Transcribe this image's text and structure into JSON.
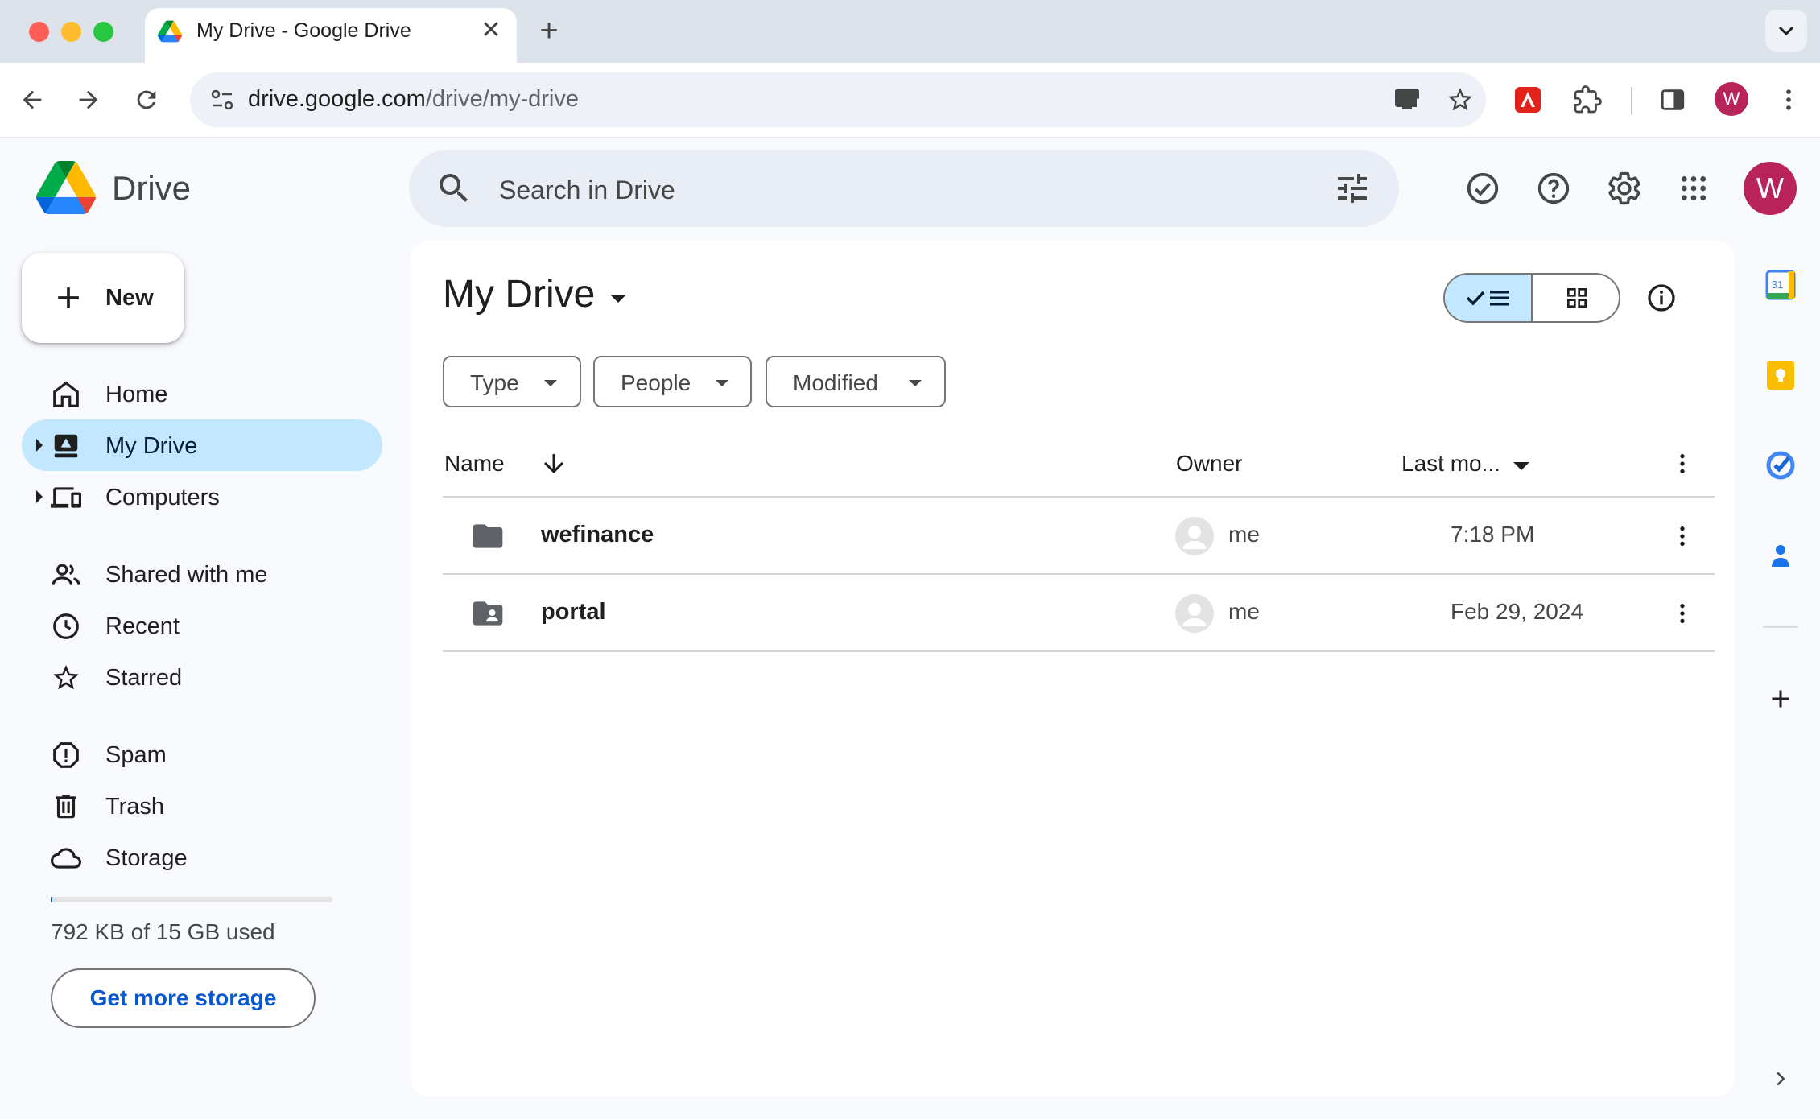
{
  "browser": {
    "tab_title": "My Drive - Google Drive",
    "url_host": "drive.google.com",
    "url_path": "/drive/my-drive",
    "profile_initial": "W"
  },
  "header": {
    "app_name": "Drive",
    "search_placeholder": "Search in Drive",
    "account_initial": "W",
    "account_color": "#b8245a"
  },
  "sidebar": {
    "new_label": "New",
    "items": [
      {
        "label": "Home",
        "icon": "home-icon"
      },
      {
        "label": "My Drive",
        "icon": "my-drive-icon",
        "active": true
      },
      {
        "label": "Computers",
        "icon": "computers-icon"
      },
      {
        "label": "Shared with me",
        "icon": "people-icon"
      },
      {
        "label": "Recent",
        "icon": "clock-icon"
      },
      {
        "label": "Starred",
        "icon": "star-icon"
      },
      {
        "label": "Spam",
        "icon": "spam-icon"
      },
      {
        "label": "Trash",
        "icon": "trash-icon"
      },
      {
        "label": "Storage",
        "icon": "cloud-icon"
      }
    ],
    "storage_used_fraction": 5e-05,
    "storage_text": "792 KB of 15 GB used",
    "get_storage_label": "Get more storage"
  },
  "main": {
    "title": "My Drive",
    "filters": [
      "Type",
      "People",
      "Modified"
    ],
    "columns": {
      "name": "Name",
      "owner": "Owner",
      "last_modified": "Last mo..."
    },
    "rows": [
      {
        "name": "wefinance",
        "type": "folder",
        "owner": "me",
        "modified": "7:18 PM"
      },
      {
        "name": "portal",
        "type": "shared-folder",
        "owner": "me",
        "modified": "Feb 29, 2024"
      }
    ]
  },
  "colors": {
    "accent": "#0b57d0",
    "active_nav": "#c2e7ff",
    "background": "#f8fafd"
  }
}
